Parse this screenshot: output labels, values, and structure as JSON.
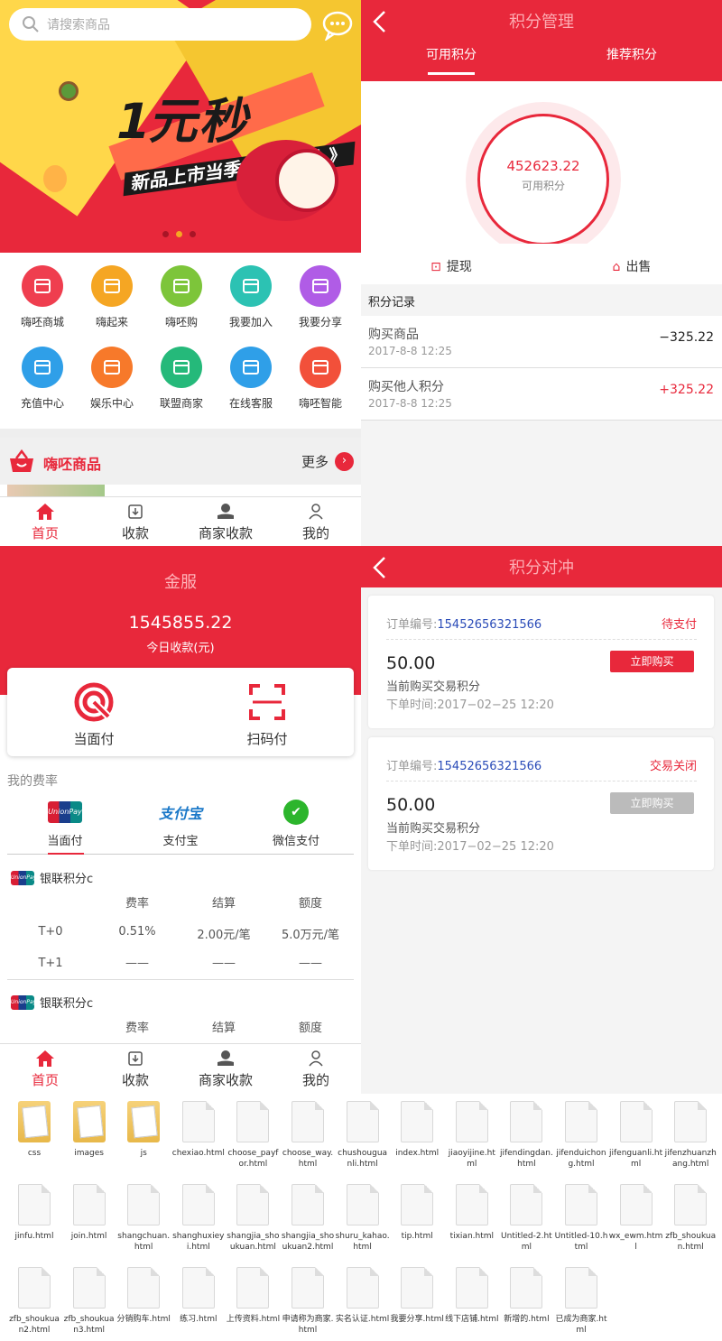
{
  "home": {
    "search_placeholder": "请搜索商品",
    "banner": {
      "big": "1元秒",
      "sub": "新品上市当季 限量秒杀 》"
    },
    "grid": [
      {
        "label": "嗨呸商城",
        "color": "#ef3e4f",
        "icon": "shop-icon"
      },
      {
        "label": "嗨起来",
        "color": "#f5a623",
        "icon": "gift-icon"
      },
      {
        "label": "嗨呸购",
        "color": "#7dc53a",
        "icon": "store-icon"
      },
      {
        "label": "我要加入",
        "color": "#2cc2b3",
        "icon": "add-user-icon"
      },
      {
        "label": "我要分享",
        "color": "#b05ce6",
        "icon": "share-icon"
      },
      {
        "label": "充值中心",
        "color": "#2f9fe8",
        "icon": "phone-icon"
      },
      {
        "label": "娱乐中心",
        "color": "#f7792a",
        "icon": "gamepad-icon"
      },
      {
        "label": "联盟商家",
        "color": "#25b97a",
        "icon": "image-icon"
      },
      {
        "label": "在线客服",
        "color": "#2f9fe8",
        "icon": "headset-icon"
      },
      {
        "label": "嗨呸智能",
        "color": "#f2503a",
        "icon": "atom-icon"
      }
    ],
    "products_title": "嗨呸商品",
    "more": "更多"
  },
  "tabbar": [
    "首页",
    "收款",
    "商家收款",
    "我的"
  ],
  "points": {
    "title": "积分管理",
    "tabs": [
      "可用积分",
      "推荐积分"
    ],
    "value": "452623.22",
    "value_label": "可用积分",
    "actions": [
      "提现",
      "出售"
    ],
    "records_title": "积分记录",
    "records": [
      {
        "name": "购买商品",
        "date": "2017-8-8 12:25",
        "amount": "−325.22",
        "color": "#222"
      },
      {
        "name": "购买他人积分",
        "date": "2017-8-8 12:25",
        "amount": "+325.22",
        "color": "#e8283b"
      }
    ]
  },
  "jinfu": {
    "title": "金服",
    "amount": "1545855.22",
    "amount_label": "今日收款(元)",
    "pay": [
      "当面付",
      "扫码付"
    ],
    "fee_label": "我的费率",
    "pay_tabs": [
      "当面付",
      "支付宝",
      "微信支付"
    ],
    "unionpay_text": "UnionPay 银联",
    "alipay_text": "支付宝",
    "wechat_text": "✔",
    "section_title": "银联积分c",
    "headers": [
      "",
      "费率",
      "结算",
      "额度"
    ],
    "rows": [
      [
        "T+0",
        "0.51%",
        "2.00元/笔",
        "5.0万元/笔"
      ],
      [
        "T+1",
        "——",
        "——",
        "——"
      ]
    ],
    "section2_title": "银联积分c",
    "headers2": [
      "",
      "费率",
      "结算",
      "额度"
    ]
  },
  "hedge": {
    "title": "积分对冲",
    "orders": [
      {
        "no_label": "订单编号:",
        "no": "15452656321566",
        "status": "待支付",
        "amount": "50.00",
        "desc": "当前购买交易积分",
        "time": "下单时间:2017−02−25 12:20",
        "btn": "立即购买",
        "disabled": false
      },
      {
        "no_label": "订单编号:",
        "no": "15452656321566",
        "status": "交易关闭",
        "amount": "50.00",
        "desc": "当前购买交易积分",
        "time": "下单时间:2017−02−25 12:20",
        "btn": "立即购买",
        "disabled": true
      }
    ]
  },
  "files": [
    {
      "name": "css",
      "type": "folder"
    },
    {
      "name": "images",
      "type": "folder"
    },
    {
      "name": "js",
      "type": "folder"
    },
    {
      "name": "chexiao.html",
      "type": "doc"
    },
    {
      "name": "choose_payfor.html",
      "type": "doc"
    },
    {
      "name": "choose_way.html",
      "type": "doc"
    },
    {
      "name": "chushouguanli.html",
      "type": "doc"
    },
    {
      "name": "index.html",
      "type": "doc"
    },
    {
      "name": "jiaoyijine.html",
      "type": "doc"
    },
    {
      "name": "jifendingdan.html",
      "type": "doc"
    },
    {
      "name": "jifenduichong.html",
      "type": "doc"
    },
    {
      "name": "jifenguanli.html",
      "type": "doc"
    },
    {
      "name": "jifenzhuanzhang.html",
      "type": "doc"
    },
    {
      "name": "jinfu.html",
      "type": "doc"
    },
    {
      "name": "join.html",
      "type": "doc"
    },
    {
      "name": "shangchuan.html",
      "type": "doc"
    },
    {
      "name": "shanghuxieyi.html",
      "type": "doc"
    },
    {
      "name": "shangjia_shoukuan.html",
      "type": "doc"
    },
    {
      "name": "shangjia_shoukuan2.html",
      "type": "doc"
    },
    {
      "name": "shuru_kahao.html",
      "type": "doc"
    },
    {
      "name": "tip.html",
      "type": "doc"
    },
    {
      "name": "tixian.html",
      "type": "doc"
    },
    {
      "name": "Untitled-2.html",
      "type": "doc"
    },
    {
      "name": "Untitled-10.html",
      "type": "doc"
    },
    {
      "name": "wx_ewm.html",
      "type": "doc"
    },
    {
      "name": "zfb_shoukuan.html",
      "type": "doc"
    },
    {
      "name": "zfb_shoukuan2.html",
      "type": "doc"
    },
    {
      "name": "zfb_shoukuan3.html",
      "type": "doc"
    },
    {
      "name": "分销购车.html",
      "type": "doc"
    },
    {
      "name": "练习.html",
      "type": "doc"
    },
    {
      "name": "上传资料.html",
      "type": "doc"
    },
    {
      "name": "申请称为商家.html",
      "type": "doc"
    },
    {
      "name": "实名认证.html",
      "type": "doc"
    },
    {
      "name": "我要分享.html",
      "type": "doc"
    },
    {
      "name": "线下店铺.html",
      "type": "doc"
    },
    {
      "name": "新增的.html",
      "type": "doc"
    },
    {
      "name": "已成为商家.html",
      "type": "doc"
    }
  ]
}
